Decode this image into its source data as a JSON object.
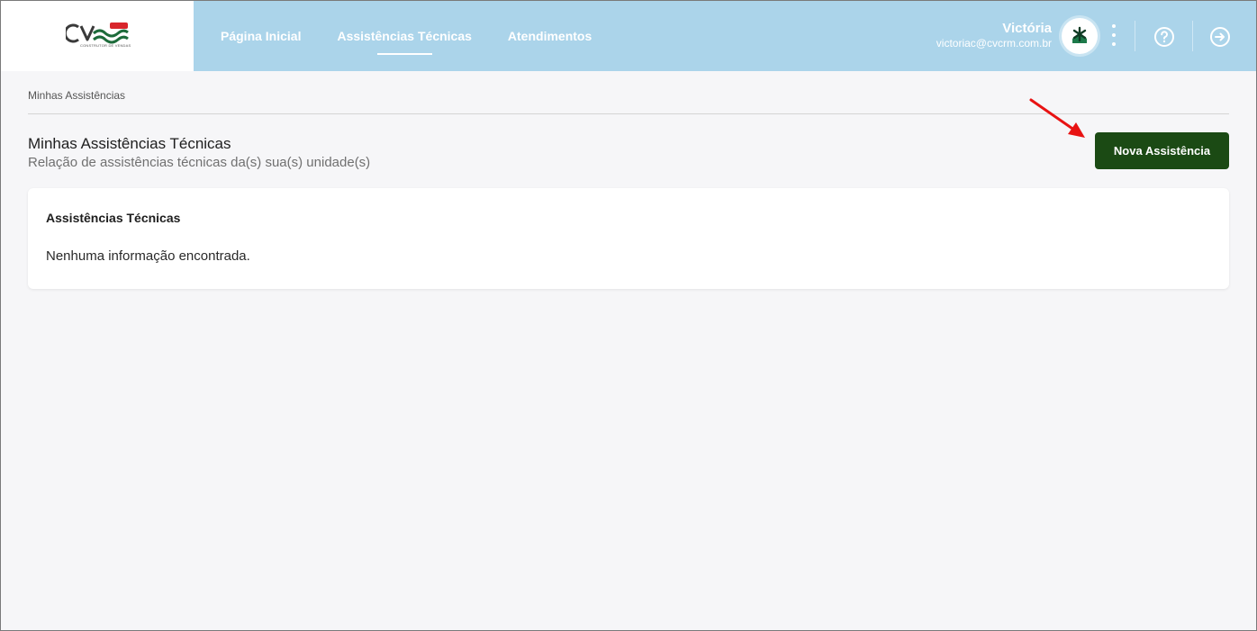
{
  "header": {
    "logo_text": "CVCRM",
    "logo_badge": "DEV",
    "logo_subtitle": "CONSTRUTOR DE VENDAS",
    "nav": [
      {
        "label": "Página Inicial",
        "active": false
      },
      {
        "label": "Assistências Técnicas",
        "active": true
      },
      {
        "label": "Atendimentos",
        "active": false
      }
    ],
    "user": {
      "name": "Victória",
      "email": "victoriac@cvcrm.com.br"
    },
    "icons": {
      "avatar": "user-avatar-icon",
      "menu": "kebab-menu-icon",
      "help": "help-circle-icon",
      "logout": "logout-icon"
    }
  },
  "breadcrumb": "Minhas Assistências",
  "page": {
    "title": "Minhas Assistências Técnicas",
    "subtitle": "Relação de assistências técnicas da(s) sua(s) unidade(s)",
    "new_button_label": "Nova Assistência"
  },
  "card": {
    "title": "Assistências Técnicas",
    "empty_message": "Nenhuma informação encontrada."
  },
  "colors": {
    "header_bg": "#abd4ea",
    "primary_button": "#1b4a14",
    "annotation_arrow": "#e81313",
    "page_bg": "#f6f6f8"
  }
}
